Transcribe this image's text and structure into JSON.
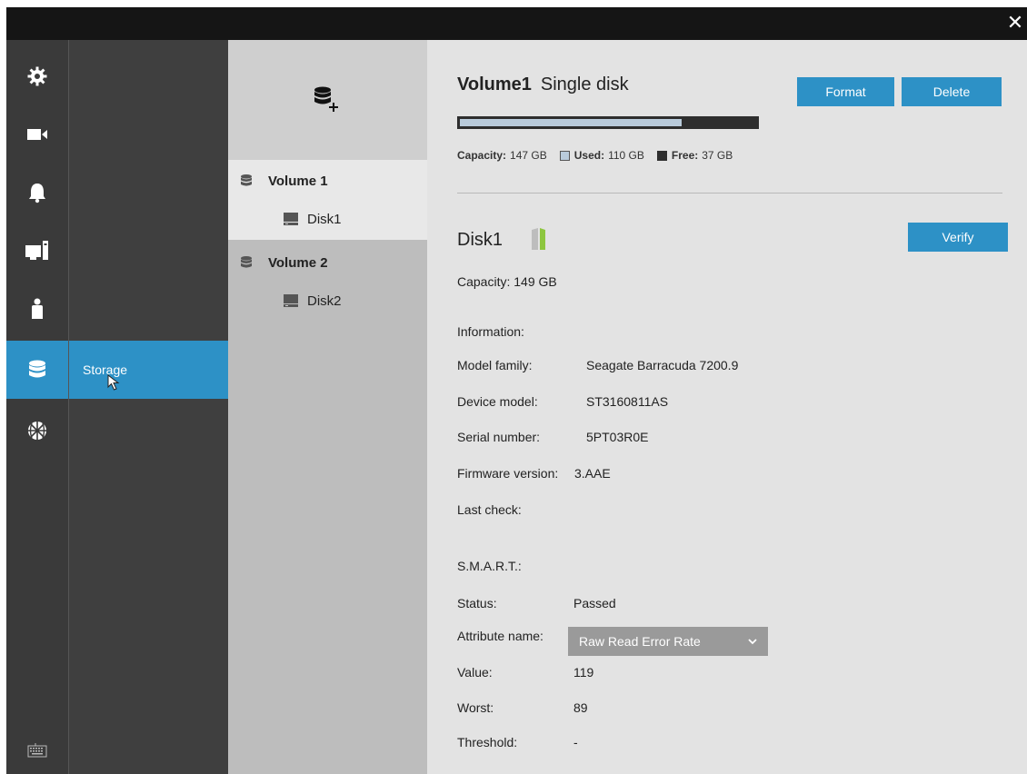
{
  "window": {
    "close_glyph": "✕"
  },
  "iconbar": {
    "items": [
      {
        "name": "gear-icon"
      },
      {
        "name": "camera-icon"
      },
      {
        "name": "bell-icon"
      },
      {
        "name": "computer-icon"
      },
      {
        "name": "user-icon"
      },
      {
        "name": "database-icon",
        "active": true
      },
      {
        "name": "network-globe-icon"
      },
      {
        "name": "keyboard-icon"
      }
    ]
  },
  "submenu": {
    "active_label": "Storage"
  },
  "volumes": [
    {
      "label": "Volume 1",
      "disks": [
        "Disk1"
      ],
      "selected": true
    },
    {
      "label": "Volume 2",
      "disks": [
        "Disk2"
      ]
    }
  ],
  "volume": {
    "name": "Volume1",
    "type": "Single disk",
    "format_label": "Format",
    "delete_label": "Delete",
    "used_fraction": 0.748,
    "capacity_label": "Capacity:",
    "capacity_value": "147 GB",
    "used_label": "Used:",
    "used_value": "110 GB",
    "free_label": "Free:",
    "free_value": "37 GB"
  },
  "disk": {
    "name": "Disk1",
    "verify_label": "Verify",
    "capacity": "Capacity: 149 GB",
    "information_label": "Information:",
    "model_family_label": "Model family:",
    "model_family": "Seagate Barracuda 7200.9",
    "device_model_label": "Device model:",
    "device_model": "ST3160811AS",
    "serial_label": "Serial number:",
    "serial": "5PT03R0E",
    "firmware_label": "Firmware version:",
    "firmware": "3.AAE",
    "last_check_label": "Last check:",
    "smart_label": "S.M.A.R.T.:",
    "status_label": "Status:",
    "status": "Passed",
    "attribute_label": "Attribute name:",
    "attribute_selected": "Raw Read Error Rate",
    "value_label": "Value:",
    "value": "119",
    "worst_label": "Worst:",
    "worst": "89",
    "threshold_label": "Threshold:",
    "threshold": "-"
  },
  "colors": {
    "accent": "#2d91c6",
    "used": "#b9cbdb",
    "free": "#2e2e2e",
    "disk_led": "#8dc63f"
  }
}
